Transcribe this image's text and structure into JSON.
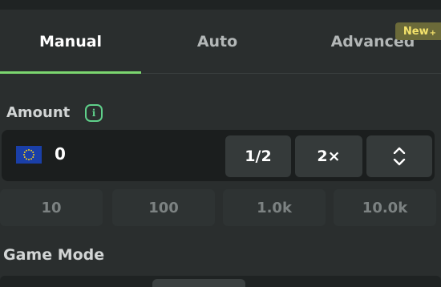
{
  "tabs": [
    {
      "label": "Manual",
      "active": true
    },
    {
      "label": "Auto",
      "active": false
    },
    {
      "label": "Advanced",
      "active": false
    }
  ],
  "badge": {
    "label": "New",
    "suffix": "+"
  },
  "amount": {
    "label": "Amount",
    "info_icon": "i",
    "currency_icon": "eu-flag-icon",
    "value": "0",
    "half_label": "1/2",
    "double_label": "2×"
  },
  "presets": [
    "10",
    "100",
    "1.0k",
    "10.0k"
  ],
  "game_mode": {
    "label": "Game Mode"
  },
  "colors": {
    "accent": "#7bd66f",
    "info": "#5fd08a",
    "badge_text": "#f5e36b"
  }
}
